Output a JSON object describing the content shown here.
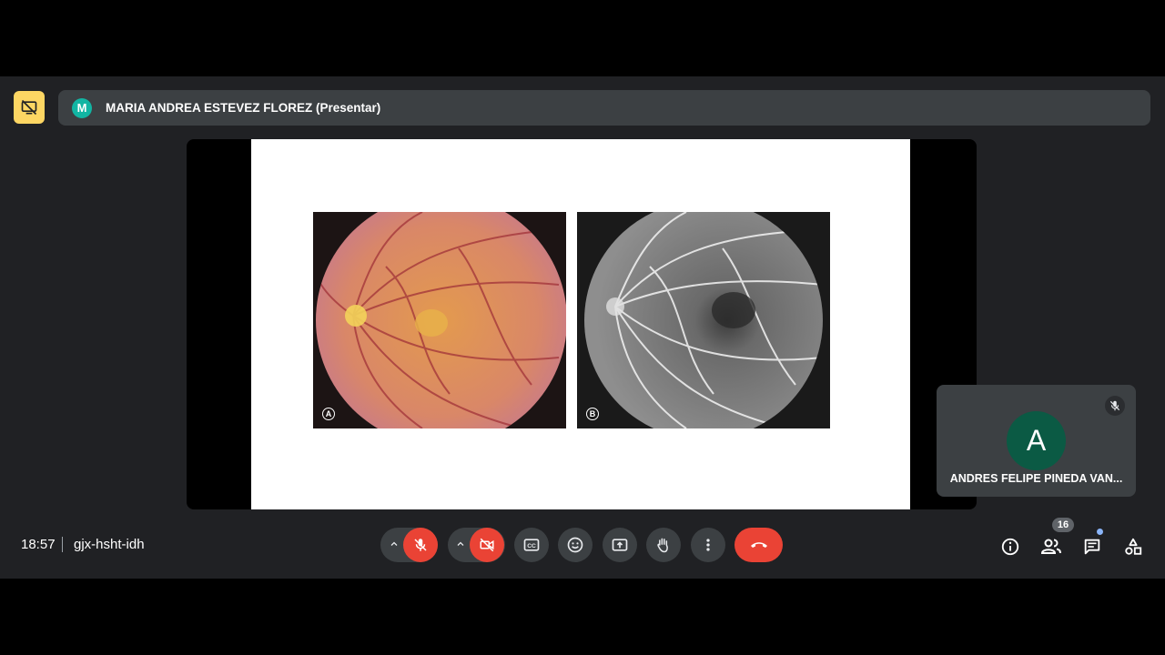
{
  "presenter": {
    "initial": "M",
    "name": "MARIA ANDREA ESTEVEZ FLOREZ (Presentar)"
  },
  "slide": {
    "panel_a_label": "A",
    "panel_b_label": "B"
  },
  "participant_tile": {
    "initial": "A",
    "name": "ANDRES FELIPE PINEDA VAN...",
    "muted": true
  },
  "meeting": {
    "time": "18:57",
    "code": "gjx-hsht-idh"
  },
  "controls": {
    "mic_off": true,
    "camera_off": true
  },
  "participants_count": "16",
  "colors": {
    "background": "#202124",
    "surface": "#3c4043",
    "danger": "#ea4335",
    "badge_yellow": "#fdd663",
    "presenter_avatar": "#12b5a3",
    "tile_avatar": "#0b5a44"
  },
  "icons": {
    "top_badge": "presentation-off-icon",
    "tile_status": "mic-off-icon",
    "info": "info-icon",
    "people": "people-icon",
    "chat": "chat-icon",
    "activities": "activities-icon"
  }
}
